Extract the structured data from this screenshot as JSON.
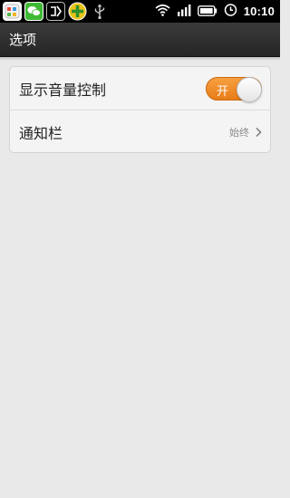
{
  "status_bar": {
    "time": "10:10",
    "notification_icons": [
      "app-manager-icon",
      "wechat-icon",
      "audio-manager-icon",
      "game-center-icon",
      "usb-icon"
    ],
    "system_icons": [
      "wifi-icon",
      "signal-icon",
      "battery-icon",
      "alarm-icon"
    ]
  },
  "header": {
    "title": "选项"
  },
  "settings": [
    {
      "label": "显示音量控制",
      "control": "toggle",
      "state": "on",
      "toggle_text": "开"
    },
    {
      "label": "通知栏",
      "control": "chevron",
      "value": "始终"
    }
  ],
  "colors": {
    "toggle_on": "#f08a24",
    "title_bar": "#2e2e2e",
    "background": "#e9e9e9"
  }
}
